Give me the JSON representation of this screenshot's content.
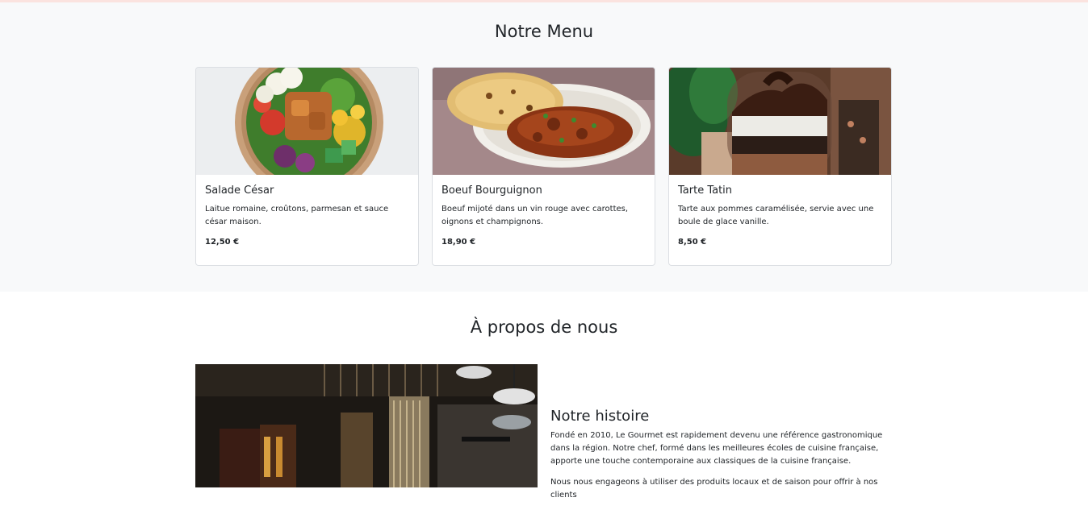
{
  "menu": {
    "title": "Notre Menu",
    "items": [
      {
        "name": "Salade César",
        "description": "Laitue romaine, croûtons, parmesan et sauce césar maison.",
        "price": "12,50 €"
      },
      {
        "name": "Boeuf Bourguignon",
        "description": "Boeuf mijoté dans un vin rouge avec carottes, oignons et champignons.",
        "price": "18,90 €"
      },
      {
        "name": "Tarte Tatin",
        "description": "Tarte aux pommes caramélisée, servie avec une boule de glace vanille.",
        "price": "8,50 €"
      }
    ]
  },
  "about": {
    "title": "À propos de nous",
    "story_heading": "Notre histoire",
    "paragraph1": "Fondé en 2010, Le Gourmet est rapidement devenu une référence gastronomique dans la région. Notre chef, formé dans les meilleures écoles de cuisine française, apporte une touche contemporaine aux classiques de la cuisine française.",
    "paragraph2": "Nous nous engageons à utiliser des produits locaux et de saison pour offrir à nos clients"
  }
}
